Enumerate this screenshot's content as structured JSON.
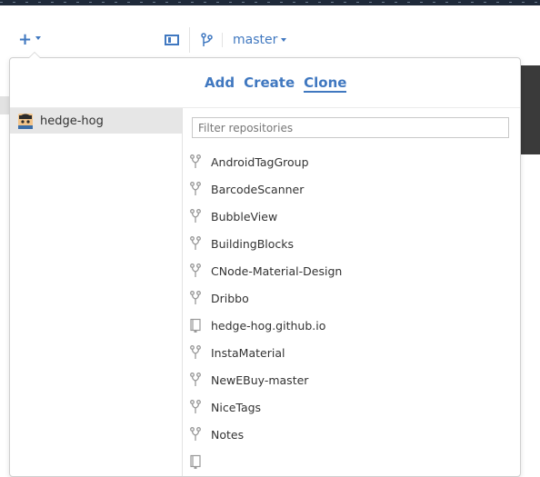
{
  "toolbar": {
    "add_icon": "plus-icon",
    "sidebar_toggle_icon": "sidebar-toggle-icon",
    "branch_icon": "branch-icon",
    "branch_name": "master"
  },
  "popover": {
    "tabs": [
      {
        "label": "Add",
        "active": false
      },
      {
        "label": "Create",
        "active": false
      },
      {
        "label": "Clone",
        "active": true
      }
    ],
    "accounts": [
      {
        "label": "hedge-hog",
        "icon": "avatar",
        "selected": true
      }
    ],
    "filter": {
      "placeholder": "Filter repositories",
      "value": ""
    },
    "repos": [
      {
        "name": "AndroidTagGroup",
        "icon": "fork-icon"
      },
      {
        "name": "BarcodeScanner",
        "icon": "fork-icon"
      },
      {
        "name": "BubbleView",
        "icon": "fork-icon"
      },
      {
        "name": "BuildingBlocks",
        "icon": "fork-icon"
      },
      {
        "name": "CNode-Material-Design",
        "icon": "fork-icon"
      },
      {
        "name": "Dribbo",
        "icon": "fork-icon"
      },
      {
        "name": "hedge-hog.github.io",
        "icon": "repo-icon"
      },
      {
        "name": "InstaMaterial",
        "icon": "fork-icon"
      },
      {
        "name": "NewEBuy-master",
        "icon": "fork-icon"
      },
      {
        "name": "NiceTags",
        "icon": "fork-icon"
      },
      {
        "name": "Notes",
        "icon": "fork-icon"
      },
      {
        "name": "",
        "icon": "repo-icon"
      }
    ]
  },
  "colors": {
    "accent": "#4078c0",
    "selected_row": "#e6e6e6",
    "text": "#333333",
    "icon_gray": "#999999"
  }
}
